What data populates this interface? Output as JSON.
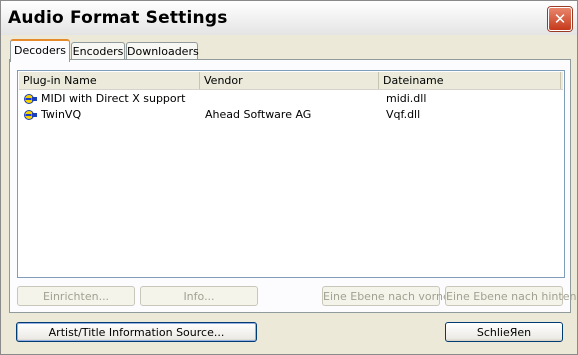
{
  "window": {
    "title": "Audio Format Settings"
  },
  "tabs": [
    {
      "label": "Decoders",
      "active": true
    },
    {
      "label": "Encoders",
      "active": false
    },
    {
      "label": "Downloaders",
      "active": false
    }
  ],
  "list": {
    "columns": [
      "Plug-in Name",
      "Vendor",
      "Dateiname"
    ],
    "rows": [
      {
        "icon": "plugin-icon",
        "name": "MIDI with Direct X support",
        "vendor": "",
        "file": "midi.dll"
      },
      {
        "icon": "plugin-icon",
        "name": "TwinVQ",
        "vendor": "Ahead Software AG",
        "file": "Vqf.dll"
      }
    ]
  },
  "buttons": {
    "configure": "Einrichten...",
    "info": "Info...",
    "level_up": "Eine Ebene nach vorne",
    "level_down": "Eine Ebene nach hinten",
    "artist_source": "Artist/Title Information Source...",
    "close": "SchlieЯen"
  },
  "colors": {
    "active_tab_accent": "#e68b2c",
    "close_button": "#c5391b",
    "plugin_icon": "#1c3fb8"
  }
}
